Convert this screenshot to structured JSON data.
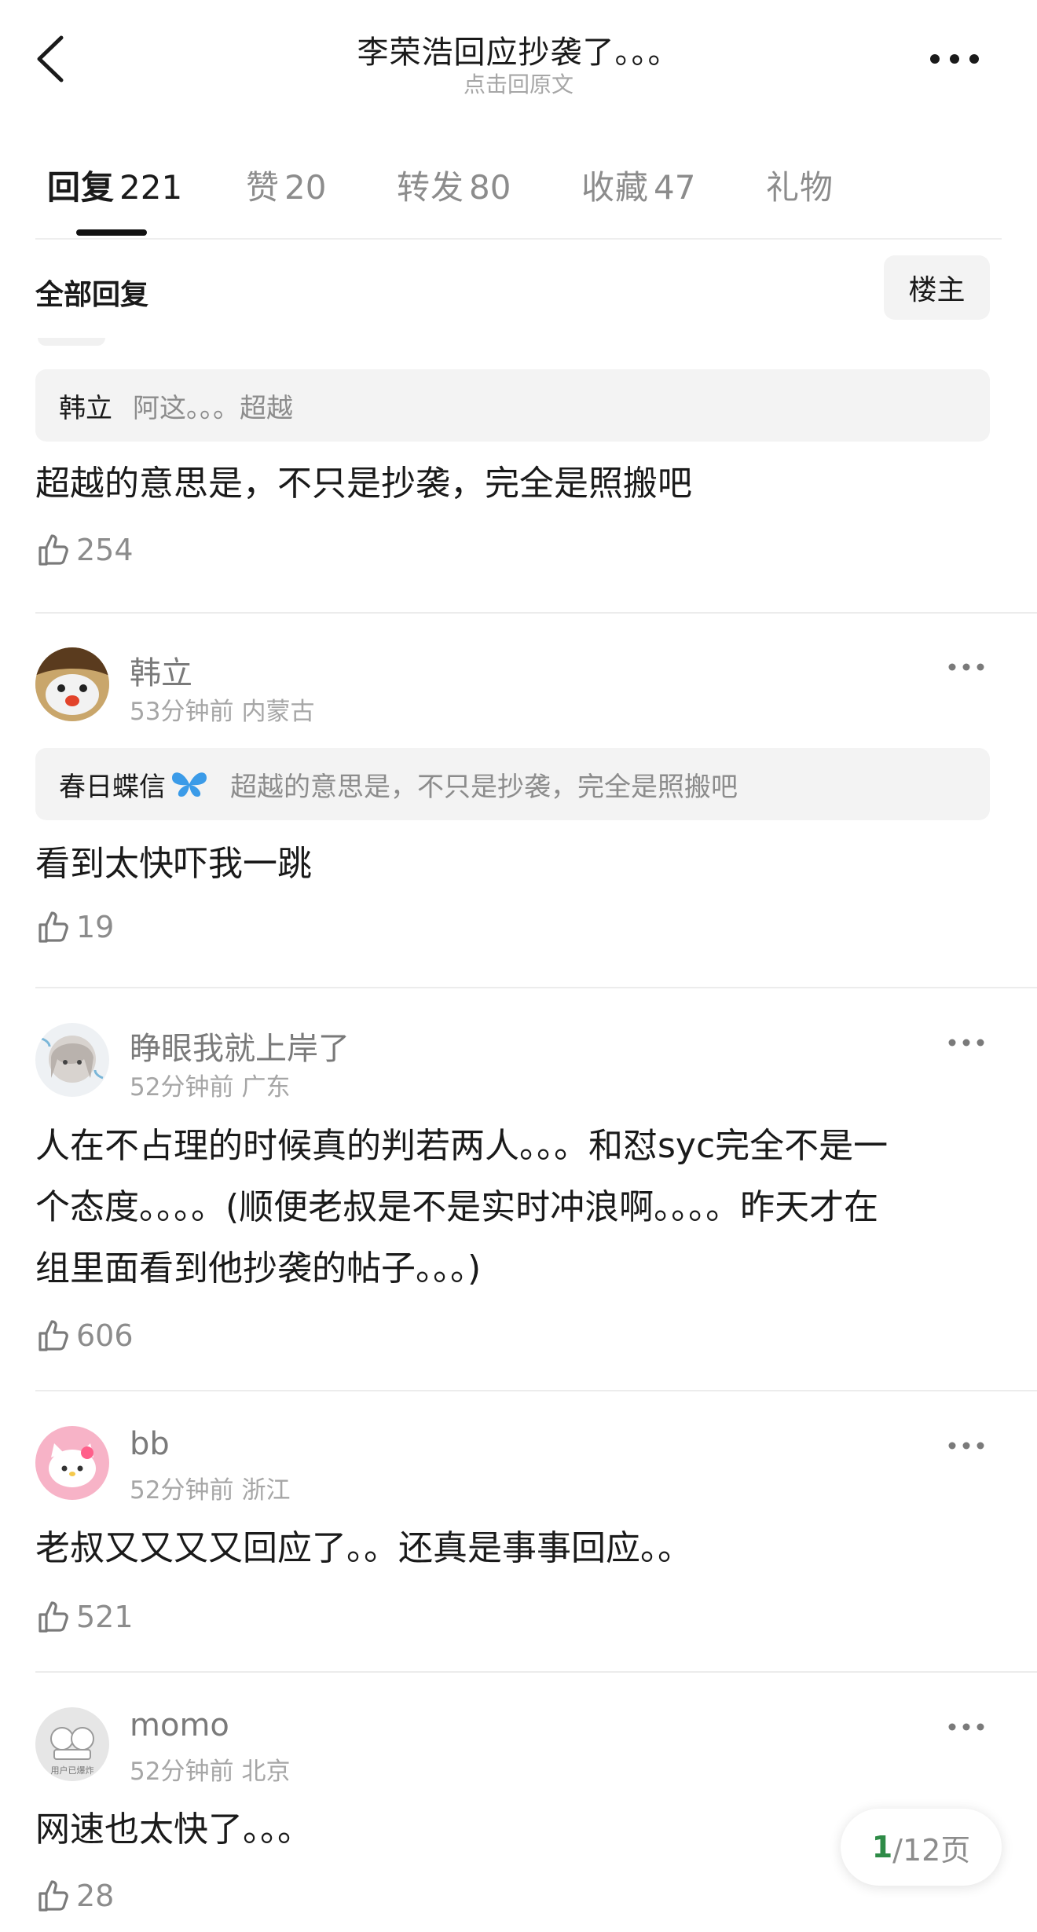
{
  "header": {
    "title": "李荣浩回应抄袭了。。。",
    "subtitle": "点击回原文"
  },
  "tabs": [
    {
      "label": "回复",
      "count": "221",
      "active": true
    },
    {
      "label": "赞",
      "count": "20",
      "active": false
    },
    {
      "label": "转发",
      "count": "80",
      "active": false
    },
    {
      "label": "收藏",
      "count": "47",
      "active": false
    },
    {
      "label": "礼物",
      "count": "",
      "active": false
    }
  ],
  "filter": {
    "label": "全部回复",
    "owner_button": "楼主"
  },
  "comments": [
    {
      "quote_author": "韩立",
      "quote_text": "阿这。。。超越",
      "text": "超越的意思是，不只是抄袭，完全是照搬吧",
      "likes": "254"
    },
    {
      "username": "韩立",
      "time": "53分钟前",
      "location": "内蒙古",
      "quote_author": "春日蝶信",
      "quote_text": "超越的意思是，不只是抄袭，完全是照搬吧",
      "text": "看到太快吓我一跳",
      "likes": "19"
    },
    {
      "username": "睁眼我就上岸了",
      "time": "52分钟前",
      "location": "广东",
      "text_lines": [
        "人在不占理的时候真的判若两人。。。和怼syc完全不是一",
        "个态度。。。。(顺便老叔是不是实时冲浪啊。。。。昨天才在",
        "组里面看到他抄袭的帖子。。。)"
      ],
      "likes": "606"
    },
    {
      "username": "bb",
      "time": "52分钟前",
      "location": "浙江",
      "text": "老叔又又又又回应了。。还真是事事回应。。",
      "likes": "521"
    },
    {
      "username": "momo",
      "time": "52分钟前",
      "location": "北京",
      "avatar_caption": "用户已爆炸",
      "text": "网速也太快了。。。",
      "likes": "28"
    }
  ],
  "pager": {
    "current": "1",
    "total": "/12页"
  },
  "icons": {
    "back": "chevron-left-icon",
    "more": "more-horizontal-icon",
    "like": "thumbs-up-icon",
    "quote_emoji": "butterfly-icon"
  },
  "colors": {
    "pager_current": "#2e8b47",
    "secondary_text": "#8c8c8c"
  }
}
